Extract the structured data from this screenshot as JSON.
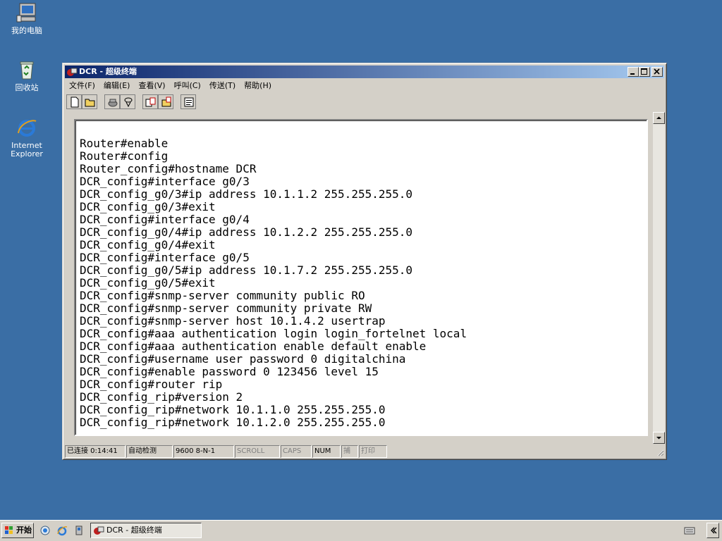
{
  "desktop": {
    "icons": [
      {
        "label": "我的电脑",
        "icon": "my-computer-icon"
      },
      {
        "label": "回收站",
        "icon": "recycle-bin-icon"
      },
      {
        "label": "Internet\nExplorer",
        "icon": "internet-explorer-icon"
      }
    ]
  },
  "window": {
    "title": "DCR - 超级终端",
    "menu": [
      {
        "label": "文件(F)"
      },
      {
        "label": "编辑(E)"
      },
      {
        "label": "查看(V)"
      },
      {
        "label": "呼叫(C)"
      },
      {
        "label": "传送(T)"
      },
      {
        "label": "帮助(H)"
      }
    ],
    "toolbar": [
      {
        "icon": "new-file-icon"
      },
      {
        "icon": "open-folder-icon"
      },
      {
        "icon": "call-icon"
      },
      {
        "icon": "disconnect-icon"
      },
      {
        "icon": "send-icon"
      },
      {
        "icon": "receive-icon"
      },
      {
        "icon": "properties-icon"
      }
    ],
    "terminal_lines": [
      "Router#enable",
      "Router#config",
      "Router_config#hostname DCR",
      "DCR_config#interface g0/3",
      "DCR_config_g0/3#ip address 10.1.1.2 255.255.255.0",
      "DCR_config_g0/3#exit",
      "DCR_config#interface g0/4",
      "DCR_config_g0/4#ip address 10.1.2.2 255.255.255.0",
      "DCR_config_g0/4#exit",
      "DCR_config#interface g0/5",
      "DCR_config_g0/5#ip address 10.1.7.2 255.255.255.0",
      "DCR_config_g0/5#exit",
      "DCR_config#snmp-server community public RO",
      "DCR_config#snmp-server community private RW",
      "DCR_config#snmp-server host 10.1.4.2 usertrap",
      "DCR_config#aaa authentication login login_fortelnet local",
      "DCR_config#aaa authentication enable default enable",
      "DCR_config#username user password 0 digitalchina",
      "DCR_config#enable password 0 123456 level 15",
      "DCR_config#router rip",
      "DCR_config_rip#version 2",
      "DCR_config_rip#network 10.1.1.0 255.255.255.0",
      "DCR_config_rip#network 10.1.2.0 255.255.255.0"
    ],
    "status": {
      "connected": "已连接 0:14:41",
      "detect": "自动检测",
      "port": "9600 8-N-1",
      "scroll": "SCROLL",
      "caps": "CAPS",
      "num": "NUM",
      "capture": "捕",
      "print": "打印"
    }
  },
  "taskbar": {
    "start_label": "开始",
    "task_label": "DCR - 超级终端"
  },
  "colors": {
    "desktop": "#3a6ea5",
    "title_active": "#0a246a",
    "title_gradient_end": "#a6caf0",
    "face": "#d4d0c8"
  }
}
